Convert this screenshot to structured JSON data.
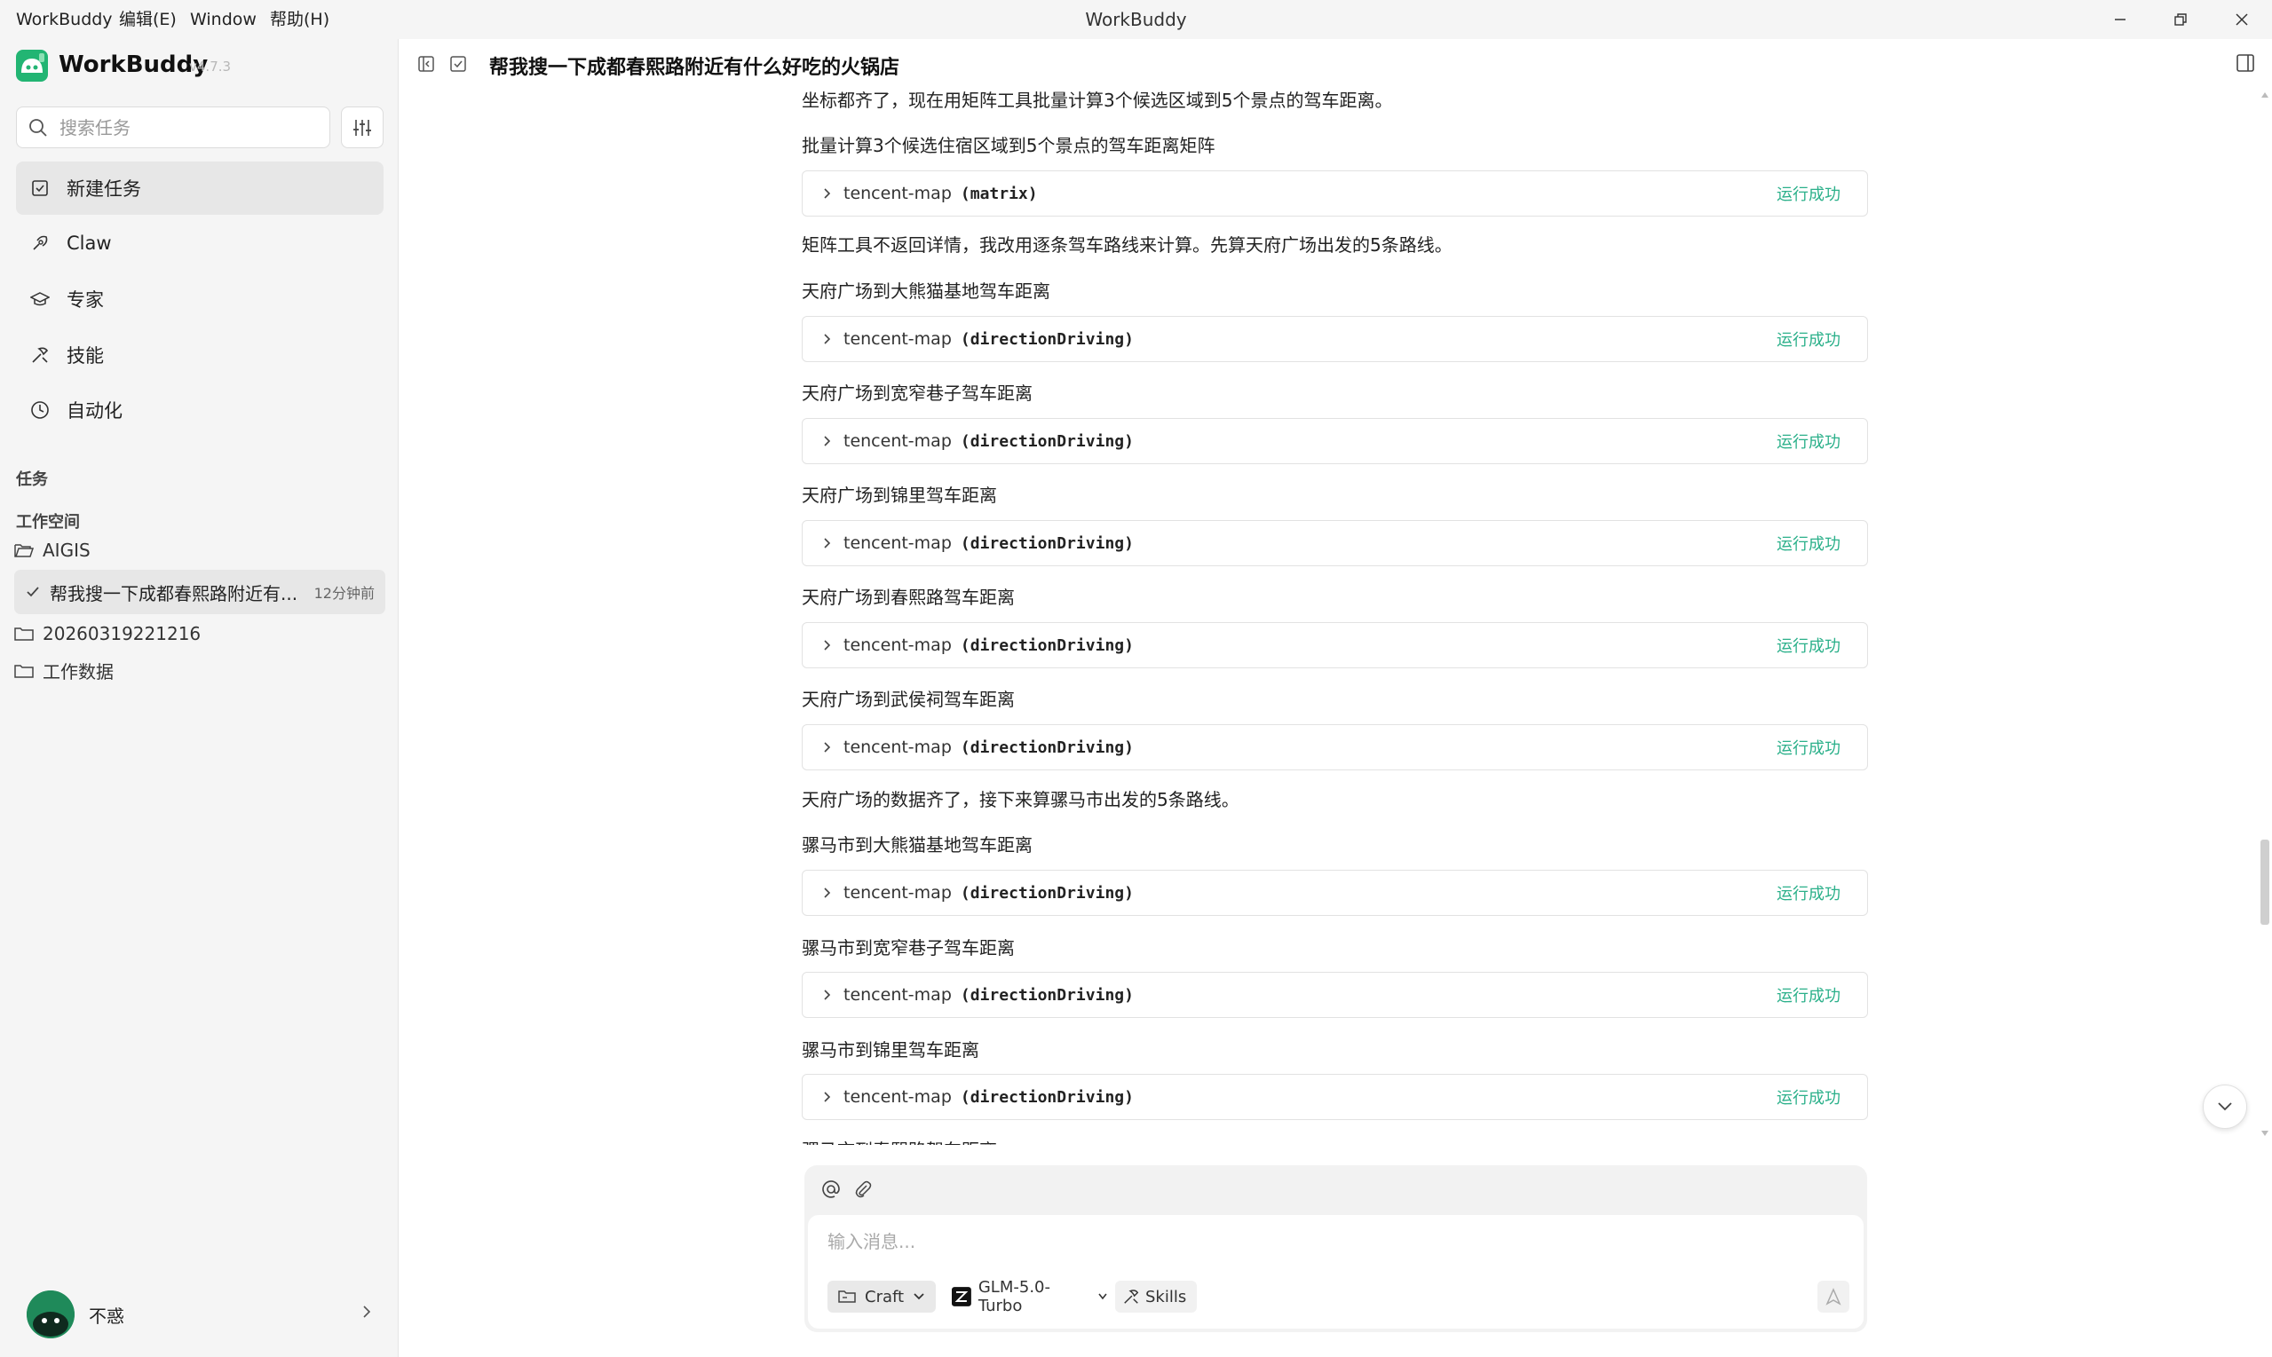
{
  "menu": {
    "app": "WorkBuddy",
    "edit": "编辑(E)",
    "window": "Window",
    "help": "帮助(H)"
  },
  "window_title": "WorkBuddy",
  "sidebar": {
    "app_name": "WorkBuddy",
    "version": "v4.7.3",
    "search_placeholder": "搜索任务",
    "nav": [
      {
        "label": "新建任务",
        "icon": "new-task-icon"
      },
      {
        "label": "Claw",
        "icon": "claw-icon"
      },
      {
        "label": "专家",
        "icon": "graduation-cap-icon"
      },
      {
        "label": "技能",
        "icon": "skill-icon"
      },
      {
        "label": "自动化",
        "icon": "clock-icon"
      }
    ],
    "tasks_label": "任务",
    "workspace_label": "工作空间",
    "folders": [
      "AIGIS",
      "20260319221216",
      "工作数据"
    ],
    "active_task": {
      "title": "帮我搜一下成都春熙路附近有...",
      "time": "12分钟前"
    },
    "user_name": "不惑"
  },
  "chat": {
    "title": "帮我搜一下成都春熙路附近有什么好吃的火锅店",
    "status_label": "运行成功",
    "tool_name": "tencent-map",
    "messages": [
      {
        "type": "text",
        "text": "坐标都齐了，现在用矩阵工具批量计算3个候选区域到5个景点的驾车距离。"
      },
      {
        "type": "text",
        "text": "批量计算3个候选住宿区域到5个景点的驾车距离矩阵"
      },
      {
        "type": "tool",
        "fn": "(matrix)"
      },
      {
        "type": "text",
        "text": "矩阵工具不返回详情，我改用逐条驾车路线来计算。先算天府广场出发的5条路线。"
      },
      {
        "type": "text",
        "text": "天府广场到大熊猫基地驾车距离"
      },
      {
        "type": "tool",
        "fn": "(directionDriving)"
      },
      {
        "type": "text",
        "text": "天府广场到宽窄巷子驾车距离"
      },
      {
        "type": "tool",
        "fn": "(directionDriving)"
      },
      {
        "type": "text",
        "text": "天府广场到锦里驾车距离"
      },
      {
        "type": "tool",
        "fn": "(directionDriving)"
      },
      {
        "type": "text",
        "text": "天府广场到春熙路驾车距离"
      },
      {
        "type": "tool",
        "fn": "(directionDriving)"
      },
      {
        "type": "text",
        "text": "天府广场到武侯祠驾车距离"
      },
      {
        "type": "tool",
        "fn": "(directionDriving)"
      },
      {
        "type": "text",
        "text": "天府广场的数据齐了，接下来算骡马市出发的5条路线。"
      },
      {
        "type": "text",
        "text": "骡马市到大熊猫基地驾车距离"
      },
      {
        "type": "tool",
        "fn": "(directionDriving)"
      },
      {
        "type": "text",
        "text": "骡马市到宽窄巷子驾车距离"
      },
      {
        "type": "tool",
        "fn": "(directionDriving)"
      },
      {
        "type": "text",
        "text": "骡马市到锦里驾车距离"
      },
      {
        "type": "tool",
        "fn": "(directionDriving)"
      },
      {
        "type": "text",
        "text": "骡马市到春熙路驾车距离"
      }
    ]
  },
  "composer": {
    "placeholder": "输入消息...",
    "mode": "Craft",
    "model": "GLM-5.0-Turbo",
    "skills": "Skills"
  },
  "colors": {
    "accent": "#2bb08a",
    "brand": "#22b573",
    "sidebar_bg": "#f5f5f5"
  }
}
